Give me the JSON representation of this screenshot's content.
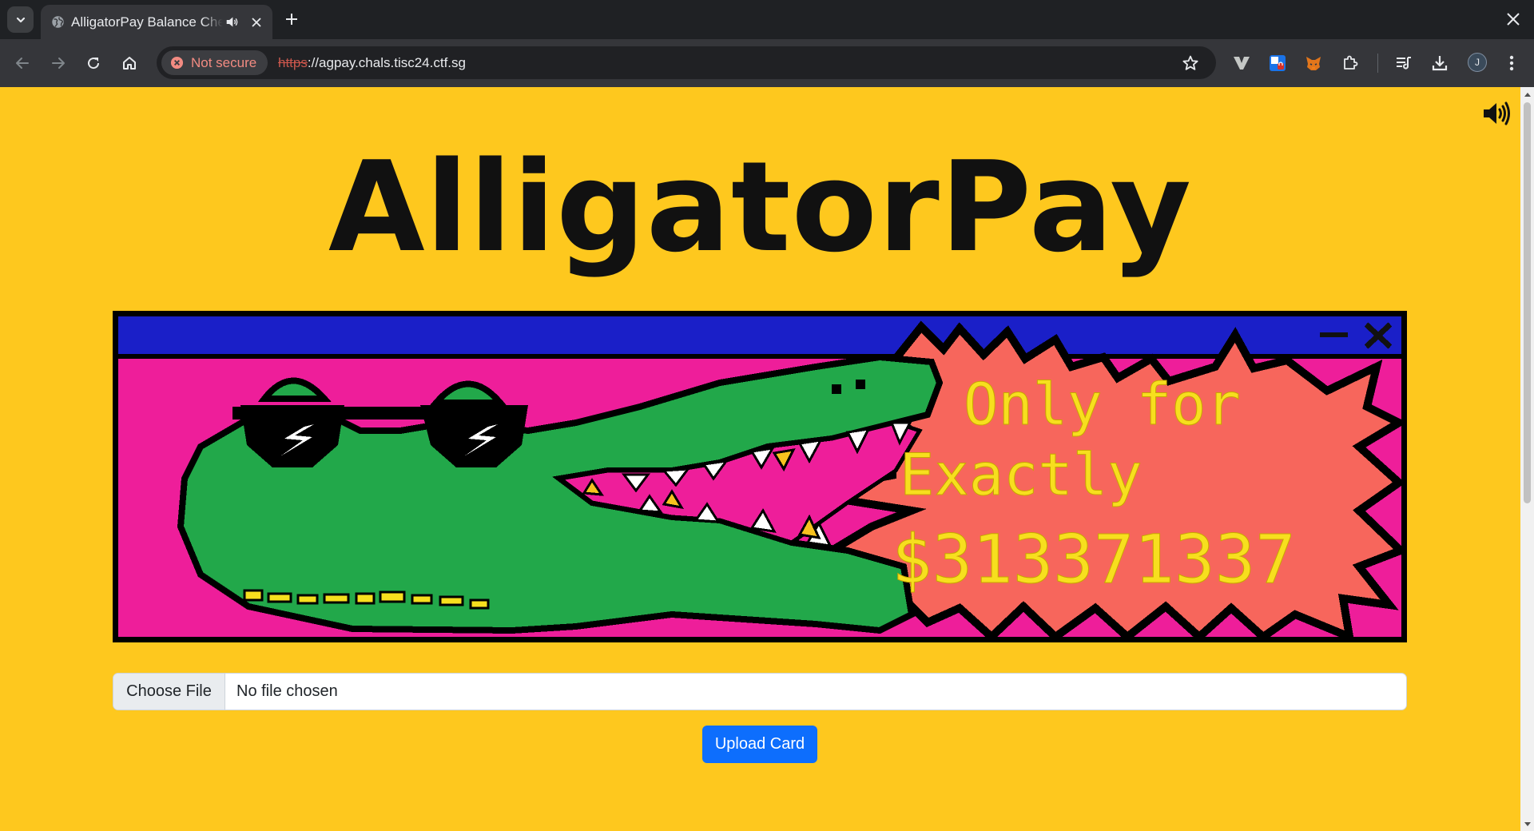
{
  "browser": {
    "tab": {
      "title": "AlligatorPay Balance Checker"
    },
    "address_bar": {
      "security_label": "Not secure",
      "url_scheme": "https",
      "url_rest": "://agpay.chals.tisc24.ctf.sg"
    },
    "profile_initial": "J",
    "icons": [
      "tab-search-icon",
      "globe-icon",
      "speaker-icon",
      "close-icon",
      "plus-icon",
      "back-icon",
      "forward-icon",
      "reload-icon",
      "home-icon",
      "not-secure-icon",
      "star-icon",
      "vivaldi-v-icon",
      "shield-extension-icon",
      "metamask-fox-icon",
      "puzzle-extensions-icon",
      "media-playlist-icon",
      "download-icon",
      "kebab-menu-icon"
    ]
  },
  "page": {
    "brand_title": "AlligatorPay",
    "banner": {
      "caption_line1": "Only for",
      "caption_line2": "Exactly",
      "caption_line3": "$313371337",
      "colors": {
        "titlebar": "#1a1fc8",
        "background": "#ee1e9a",
        "alligator": "#22a84a",
        "burst": "#f7665c",
        "text": "#f7df1e"
      }
    },
    "file_input": {
      "button_label": "Choose File",
      "status": "No file chosen"
    },
    "upload_button": "Upload Card",
    "colors": {
      "page_background": "#fec81e",
      "primary_button": "#0d6efd"
    }
  }
}
